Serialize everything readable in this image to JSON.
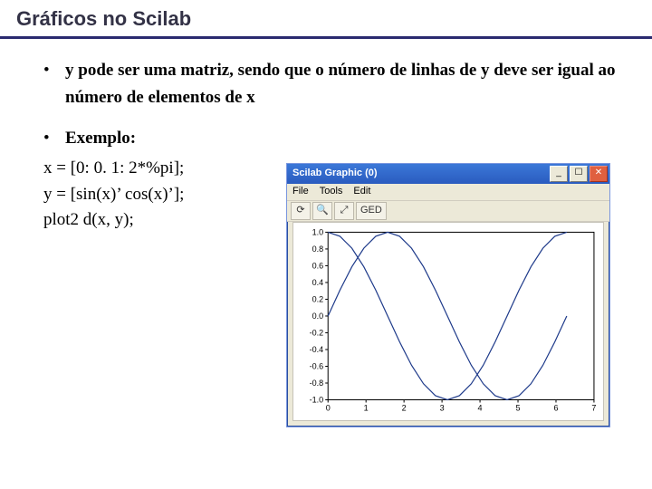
{
  "title": "Gráficos no Scilab",
  "bullets": {
    "b1": "y pode ser uma matriz, sendo que o número de linhas de y deve ser igual ao número de elementos de x",
    "b2_label": "Exemplo:"
  },
  "code": {
    "l1": "x = [0: 0. 1: 2*%pi];",
    "l2": "y = [sin(x)’ cos(x)’];",
    "l3": "plot2 d(x, y);"
  },
  "window": {
    "title": "Scilab Graphic (0)",
    "btn_min": "_",
    "btn_max": "☐",
    "btn_close": "✕",
    "menu": {
      "file": "File",
      "tools": "Tools",
      "edit": "Edit"
    },
    "tools": {
      "t1": "⟳",
      "t2": "🔍",
      "t3": "⤢",
      "t4": "GED"
    }
  },
  "chart_data": {
    "type": "line",
    "xlabel": "",
    "ylabel": "",
    "xlim": [
      0,
      7
    ],
    "ylim": [
      -1.0,
      1.0
    ],
    "x_ticks": [
      0,
      1,
      2,
      3,
      4,
      5,
      6,
      7
    ],
    "y_ticks": [
      -1.0,
      -0.8,
      -0.6,
      -0.4,
      -0.2,
      0.0,
      0.2,
      0.4,
      0.6,
      0.8,
      1.0
    ],
    "x_tick_labels": [
      "0",
      "1",
      "2",
      "3",
      "4",
      "5",
      "6",
      "7"
    ],
    "y_tick_labels": [
      "-1.0",
      "-0.8",
      "-0.6",
      "-0.4",
      "-0.2",
      "0.0",
      "0.2",
      "0.4",
      "0.6",
      "0.8",
      "1.0"
    ],
    "series": [
      {
        "name": "sin(x)",
        "x": [
          0,
          0.314,
          0.628,
          0.942,
          1.257,
          1.571,
          1.885,
          2.199,
          2.513,
          2.827,
          3.142,
          3.456,
          3.77,
          4.084,
          4.398,
          4.712,
          5.027,
          5.341,
          5.655,
          5.969,
          6.283
        ],
        "y": [
          0,
          0.309,
          0.588,
          0.809,
          0.951,
          1.0,
          0.951,
          0.809,
          0.588,
          0.309,
          0,
          -0.309,
          -0.588,
          -0.809,
          -0.951,
          -1.0,
          -0.951,
          -0.809,
          -0.588,
          -0.309,
          0
        ]
      },
      {
        "name": "cos(x)",
        "x": [
          0,
          0.314,
          0.628,
          0.942,
          1.257,
          1.571,
          1.885,
          2.199,
          2.513,
          2.827,
          3.142,
          3.456,
          3.77,
          4.084,
          4.398,
          4.712,
          5.027,
          5.341,
          5.655,
          5.969,
          6.283
        ],
        "y": [
          1.0,
          0.951,
          0.809,
          0.588,
          0.309,
          0,
          -0.309,
          -0.588,
          -0.809,
          -0.951,
          -1.0,
          -0.951,
          -0.809,
          -0.588,
          -0.309,
          0,
          0.309,
          0.588,
          0.809,
          0.951,
          1.0
        ]
      }
    ]
  }
}
